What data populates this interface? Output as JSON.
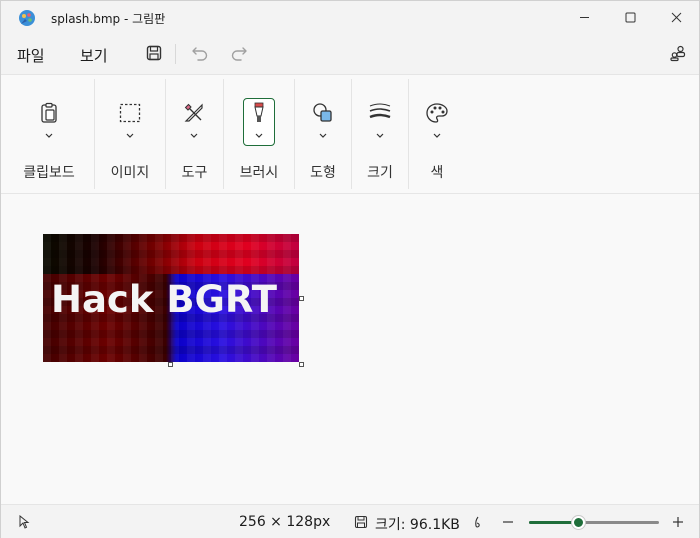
{
  "window": {
    "title": "splash.bmp - 그림판"
  },
  "menubar": {
    "file_label": "파일",
    "view_label": "보기"
  },
  "ribbon": {
    "groups": [
      {
        "label": "클립보드",
        "icon": "clipboard-icon"
      },
      {
        "label": "이미지",
        "icon": "selection-icon"
      },
      {
        "label": "도구",
        "icon": "tools-icon"
      },
      {
        "label": "브러시",
        "icon": "brush-icon"
      },
      {
        "label": "도형",
        "icon": "shapes-icon"
      },
      {
        "label": "크기",
        "icon": "stroke-size-icon"
      },
      {
        "label": "색",
        "icon": "palette-icon"
      }
    ]
  },
  "canvas": {
    "image_text": "Hack BGRT"
  },
  "statusbar": {
    "dimensions": "256 × 128px",
    "size_label": "크기: 96.1KB",
    "zoom_fraction": 0.38
  },
  "colors": {
    "accent": "#1f6e3a",
    "background": "#f9f9f9",
    "titlebar": "#f3f3f3"
  }
}
